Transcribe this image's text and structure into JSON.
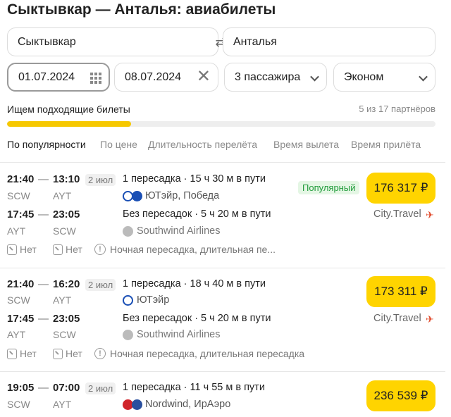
{
  "title": "Сыктывкар — Анталья: авиабилеты",
  "search": {
    "from": "Сыктывкар",
    "to": "Анталья",
    "date_from": "01.07.2024",
    "date_to": "08.07.2024",
    "passengers": "3 пассажира",
    "class": "Эконом"
  },
  "status": {
    "searching": "Ищем подходящие билеты",
    "partners": "5 из 17 партнёров",
    "progress": 0.29
  },
  "sort_tabs": [
    "По популярности",
    "По цене",
    "Длительность перелёта",
    "Время вылета",
    "Время прилёта"
  ],
  "results": [
    {
      "out": {
        "dep": "21:40",
        "arr": "13:10",
        "date": "2 июл",
        "from": "SCW",
        "to": "AYT",
        "info": "1 пересадка · 15 ч 30 м в пути",
        "airline": "ЮТэйр, Победа"
      },
      "ret": {
        "dep": "17:45",
        "arr": "23:05",
        "from": "AYT",
        "to": "SCW",
        "info": "Без пересадок · 5 ч 20 м в пути",
        "airline": "Southwind Airlines"
      },
      "badge": "Популярный",
      "price": "176 317 ₽",
      "seller": "City.Travel",
      "baggage": "Нет",
      "handluggage": "Нет",
      "warning": "Ночная пересадка, длительная пе..."
    },
    {
      "out": {
        "dep": "21:40",
        "arr": "16:20",
        "date": "2 июл",
        "from": "SCW",
        "to": "AYT",
        "info": "1 пересадка · 18 ч 40 м в пути",
        "airline": "ЮТэйр"
      },
      "ret": {
        "dep": "17:45",
        "arr": "23:05",
        "from": "AYT",
        "to": "SCW",
        "info": "Без пересадок · 5 ч 20 м в пути",
        "airline": "Southwind Airlines"
      },
      "price": "173 311 ₽",
      "seller": "City.Travel",
      "baggage": "Нет",
      "handluggage": "Нет",
      "warning": "Ночная пересадка, длительная пересадка"
    },
    {
      "out": {
        "dep": "19:05",
        "arr": "07:00",
        "date": "2 июл",
        "from": "SCW",
        "to": "AYT",
        "info": "1 пересадка · 11 ч 55 м в пути",
        "airline": "Nordwind, ИрАэро"
      },
      "price": "236 539 ₽"
    }
  ]
}
